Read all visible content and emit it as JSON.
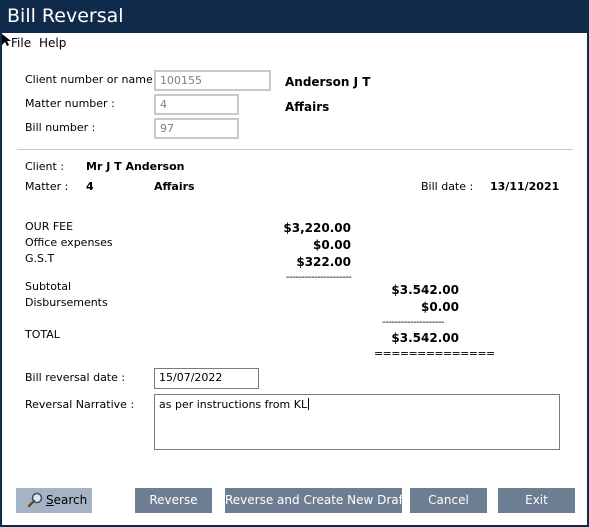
{
  "window": {
    "title": "Bill Reversal"
  },
  "menu": {
    "file": "File",
    "help": "Help"
  },
  "lookup": {
    "client_label": "Client number or name :",
    "client_value": "100155",
    "client_name": "Anderson J T",
    "matter_label": "Matter number :",
    "matter_value": "4",
    "matter_name": "Affairs",
    "bill_label": "Bill number :",
    "bill_value": "97"
  },
  "details": {
    "client_label": "Client :",
    "client_value": "Mr J T Anderson",
    "matter_label": "Matter :",
    "matter_number": "4",
    "matter_name": "Affairs",
    "bill_date_label": "Bill date :",
    "bill_date": "13/11/2021"
  },
  "amounts": {
    "our_fee_label": "OUR FEE",
    "our_fee": "$3,220.00",
    "office_exp_label": "Office expenses",
    "office_exp": "$0.00",
    "gst_label": "G.S.T",
    "gst": "$322.00",
    "sep1": "---------------------",
    "subtotal_label": "Subtotal",
    "subtotal": "$3.542.00",
    "disb_label": "Disbursements",
    "disb": "$0.00",
    "sep2": "--------------------",
    "total_label": "TOTAL",
    "total": "$3.542.00",
    "sep3": "=============="
  },
  "reversal": {
    "date_label": "Bill reversal date :",
    "date_value": "15/07/2022",
    "narrative_label": "Reversal Narrative :",
    "narrative_value": "as per instructions from KL"
  },
  "buttons": {
    "search_prefix": "S",
    "search_rest": "earch",
    "reverse": "Reverse",
    "reverse_new": "Reverse and Create New Draft Bill",
    "cancel": "Cancel",
    "exit": "Exit"
  },
  "icons": {
    "search": "magnifier-icon",
    "cursor": "move-cursor-icon"
  }
}
